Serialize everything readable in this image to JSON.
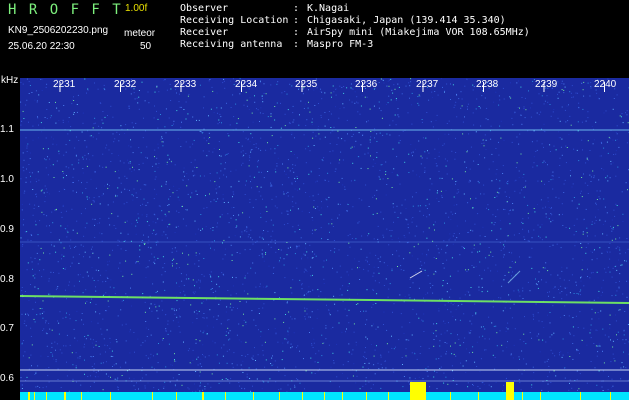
{
  "header": {
    "app_title": "H R O F F T",
    "version": "1.00f",
    "filename": "KN9_2506202230.png",
    "datetime": "25.06.20 22:30",
    "meteor_label": "meteor",
    "meteor_count": "50",
    "meta": [
      {
        "key": "Observer",
        "sep": ":",
        "value": "K.Nagai"
      },
      {
        "key": "Receiving Location",
        "sep": ":",
        "value": "Chigasaki, Japan (139.414 35.340)"
      },
      {
        "key": "Receiver",
        "sep": ":",
        "value": "AirSpy mini (Miakejima VOR 108.65MHz)"
      },
      {
        "key": "Receiving antenna",
        "sep": ":",
        "value": "Maspro FM-3"
      }
    ]
  },
  "axes": {
    "y_unit": "kHz",
    "y_ticks": [
      "1.1",
      "1.0",
      "0.9",
      "0.8",
      "0.7",
      "0.6"
    ],
    "x_ticks": [
      "2231",
      "2232",
      "2233",
      "2234",
      "2235",
      "2236",
      "2237",
      "2238",
      "2239",
      "2240"
    ]
  },
  "colors": {
    "background": "#1a2aa0",
    "title_green": "#7df07d",
    "version_yellow": "#e8e000",
    "signal_cyan": "#00e5ff",
    "burst_yellow": "#ffff00",
    "trace_green": "#7cff5a"
  }
}
